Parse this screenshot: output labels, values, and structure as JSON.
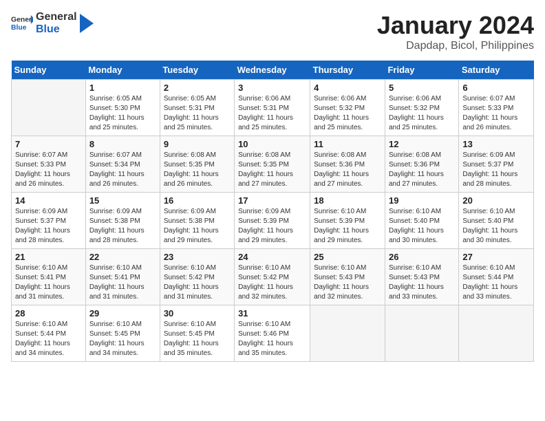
{
  "header": {
    "logo_general": "General",
    "logo_blue": "Blue",
    "title": "January 2024",
    "subtitle": "Dapdap, Bicol, Philippines"
  },
  "columns": [
    "Sunday",
    "Monday",
    "Tuesday",
    "Wednesday",
    "Thursday",
    "Friday",
    "Saturday"
  ],
  "weeks": [
    [
      {
        "day": "",
        "sunrise": "",
        "sunset": "",
        "daylight": ""
      },
      {
        "day": "1",
        "sunrise": "Sunrise: 6:05 AM",
        "sunset": "Sunset: 5:30 PM",
        "daylight": "Daylight: 11 hours and 25 minutes."
      },
      {
        "day": "2",
        "sunrise": "Sunrise: 6:05 AM",
        "sunset": "Sunset: 5:31 PM",
        "daylight": "Daylight: 11 hours and 25 minutes."
      },
      {
        "day": "3",
        "sunrise": "Sunrise: 6:06 AM",
        "sunset": "Sunset: 5:31 PM",
        "daylight": "Daylight: 11 hours and 25 minutes."
      },
      {
        "day": "4",
        "sunrise": "Sunrise: 6:06 AM",
        "sunset": "Sunset: 5:32 PM",
        "daylight": "Daylight: 11 hours and 25 minutes."
      },
      {
        "day": "5",
        "sunrise": "Sunrise: 6:06 AM",
        "sunset": "Sunset: 5:32 PM",
        "daylight": "Daylight: 11 hours and 25 minutes."
      },
      {
        "day": "6",
        "sunrise": "Sunrise: 6:07 AM",
        "sunset": "Sunset: 5:33 PM",
        "daylight": "Daylight: 11 hours and 26 minutes."
      }
    ],
    [
      {
        "day": "7",
        "sunrise": "Sunrise: 6:07 AM",
        "sunset": "Sunset: 5:33 PM",
        "daylight": "Daylight: 11 hours and 26 minutes."
      },
      {
        "day": "8",
        "sunrise": "Sunrise: 6:07 AM",
        "sunset": "Sunset: 5:34 PM",
        "daylight": "Daylight: 11 hours and 26 minutes."
      },
      {
        "day": "9",
        "sunrise": "Sunrise: 6:08 AM",
        "sunset": "Sunset: 5:35 PM",
        "daylight": "Daylight: 11 hours and 26 minutes."
      },
      {
        "day": "10",
        "sunrise": "Sunrise: 6:08 AM",
        "sunset": "Sunset: 5:35 PM",
        "daylight": "Daylight: 11 hours and 27 minutes."
      },
      {
        "day": "11",
        "sunrise": "Sunrise: 6:08 AM",
        "sunset": "Sunset: 5:36 PM",
        "daylight": "Daylight: 11 hours and 27 minutes."
      },
      {
        "day": "12",
        "sunrise": "Sunrise: 6:08 AM",
        "sunset": "Sunset: 5:36 PM",
        "daylight": "Daylight: 11 hours and 27 minutes."
      },
      {
        "day": "13",
        "sunrise": "Sunrise: 6:09 AM",
        "sunset": "Sunset: 5:37 PM",
        "daylight": "Daylight: 11 hours and 28 minutes."
      }
    ],
    [
      {
        "day": "14",
        "sunrise": "Sunrise: 6:09 AM",
        "sunset": "Sunset: 5:37 PM",
        "daylight": "Daylight: 11 hours and 28 minutes."
      },
      {
        "day": "15",
        "sunrise": "Sunrise: 6:09 AM",
        "sunset": "Sunset: 5:38 PM",
        "daylight": "Daylight: 11 hours and 28 minutes."
      },
      {
        "day": "16",
        "sunrise": "Sunrise: 6:09 AM",
        "sunset": "Sunset: 5:38 PM",
        "daylight": "Daylight: 11 hours and 29 minutes."
      },
      {
        "day": "17",
        "sunrise": "Sunrise: 6:09 AM",
        "sunset": "Sunset: 5:39 PM",
        "daylight": "Daylight: 11 hours and 29 minutes."
      },
      {
        "day": "18",
        "sunrise": "Sunrise: 6:10 AM",
        "sunset": "Sunset: 5:39 PM",
        "daylight": "Daylight: 11 hours and 29 minutes."
      },
      {
        "day": "19",
        "sunrise": "Sunrise: 6:10 AM",
        "sunset": "Sunset: 5:40 PM",
        "daylight": "Daylight: 11 hours and 30 minutes."
      },
      {
        "day": "20",
        "sunrise": "Sunrise: 6:10 AM",
        "sunset": "Sunset: 5:40 PM",
        "daylight": "Daylight: 11 hours and 30 minutes."
      }
    ],
    [
      {
        "day": "21",
        "sunrise": "Sunrise: 6:10 AM",
        "sunset": "Sunset: 5:41 PM",
        "daylight": "Daylight: 11 hours and 31 minutes."
      },
      {
        "day": "22",
        "sunrise": "Sunrise: 6:10 AM",
        "sunset": "Sunset: 5:41 PM",
        "daylight": "Daylight: 11 hours and 31 minutes."
      },
      {
        "day": "23",
        "sunrise": "Sunrise: 6:10 AM",
        "sunset": "Sunset: 5:42 PM",
        "daylight": "Daylight: 11 hours and 31 minutes."
      },
      {
        "day": "24",
        "sunrise": "Sunrise: 6:10 AM",
        "sunset": "Sunset: 5:42 PM",
        "daylight": "Daylight: 11 hours and 32 minutes."
      },
      {
        "day": "25",
        "sunrise": "Sunrise: 6:10 AM",
        "sunset": "Sunset: 5:43 PM",
        "daylight": "Daylight: 11 hours and 32 minutes."
      },
      {
        "day": "26",
        "sunrise": "Sunrise: 6:10 AM",
        "sunset": "Sunset: 5:43 PM",
        "daylight": "Daylight: 11 hours and 33 minutes."
      },
      {
        "day": "27",
        "sunrise": "Sunrise: 6:10 AM",
        "sunset": "Sunset: 5:44 PM",
        "daylight": "Daylight: 11 hours and 33 minutes."
      }
    ],
    [
      {
        "day": "28",
        "sunrise": "Sunrise: 6:10 AM",
        "sunset": "Sunset: 5:44 PM",
        "daylight": "Daylight: 11 hours and 34 minutes."
      },
      {
        "day": "29",
        "sunrise": "Sunrise: 6:10 AM",
        "sunset": "Sunset: 5:45 PM",
        "daylight": "Daylight: 11 hours and 34 minutes."
      },
      {
        "day": "30",
        "sunrise": "Sunrise: 6:10 AM",
        "sunset": "Sunset: 5:45 PM",
        "daylight": "Daylight: 11 hours and 35 minutes."
      },
      {
        "day": "31",
        "sunrise": "Sunrise: 6:10 AM",
        "sunset": "Sunset: 5:46 PM",
        "daylight": "Daylight: 11 hours and 35 minutes."
      },
      {
        "day": "",
        "sunrise": "",
        "sunset": "",
        "daylight": ""
      },
      {
        "day": "",
        "sunrise": "",
        "sunset": "",
        "daylight": ""
      },
      {
        "day": "",
        "sunrise": "",
        "sunset": "",
        "daylight": ""
      }
    ]
  ]
}
